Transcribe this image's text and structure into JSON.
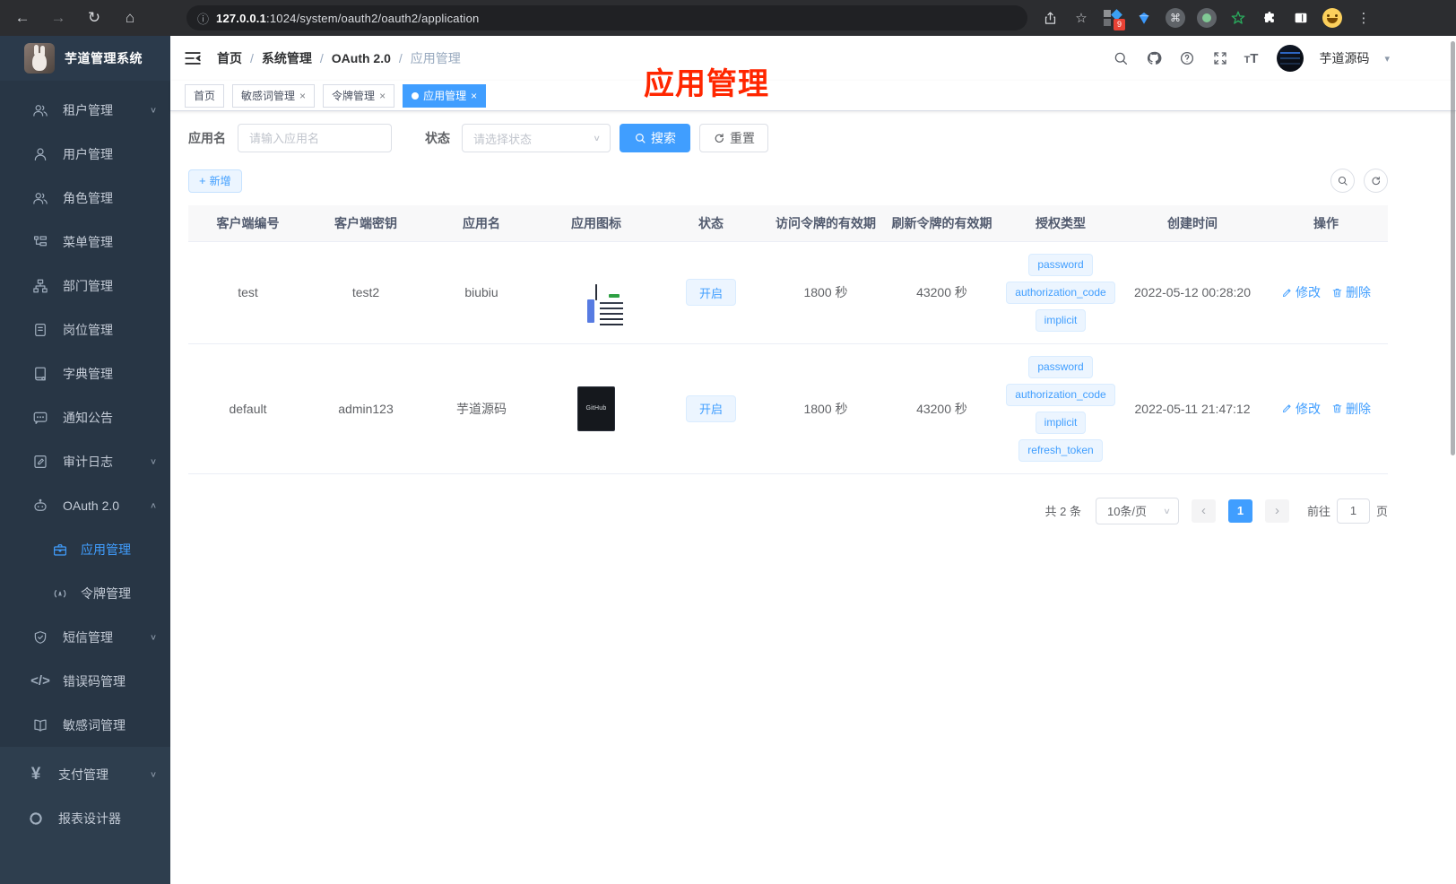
{
  "browser": {
    "url_host": "127.0.0.1",
    "url_path": ":1024/system/oauth2/oauth2/application",
    "extension_badge": "9"
  },
  "sidebar": {
    "title": "芋道管理系统",
    "items": [
      {
        "label": "租户管理"
      },
      {
        "label": "用户管理"
      },
      {
        "label": "角色管理"
      },
      {
        "label": "菜单管理"
      },
      {
        "label": "部门管理"
      },
      {
        "label": "岗位管理"
      },
      {
        "label": "字典管理"
      },
      {
        "label": "通知公告"
      },
      {
        "label": "审计日志"
      },
      {
        "label": "OAuth 2.0"
      },
      {
        "label": "应用管理"
      },
      {
        "label": "令牌管理"
      },
      {
        "label": "短信管理"
      },
      {
        "label": "错误码管理"
      },
      {
        "label": "敏感词管理"
      },
      {
        "label": "支付管理"
      },
      {
        "label": "报表设计器"
      }
    ]
  },
  "header": {
    "breadcrumb": {
      "home": "首页",
      "level1": "系统管理",
      "level2": "OAuth 2.0",
      "current": "应用管理",
      "separator": "/"
    },
    "username": "芋道源码"
  },
  "tabs": [
    {
      "label": "首页"
    },
    {
      "label": "敏感词管理"
    },
    {
      "label": "令牌管理"
    },
    {
      "label": "应用管理"
    }
  ],
  "annotation": "应用管理",
  "filter": {
    "name_label": "应用名",
    "name_placeholder": "请输入应用名",
    "status_label": "状态",
    "status_placeholder": "请选择状态",
    "search": "搜索",
    "reset": "重置",
    "add": "新增"
  },
  "table": {
    "columns": [
      "客户端编号",
      "客户端密钥",
      "应用名",
      "应用图标",
      "状态",
      "访问令牌的有效期",
      "刷新令牌的有效期",
      "授权类型",
      "创建时间",
      "操作"
    ],
    "rows": [
      {
        "client_id": "test",
        "client_secret": "test2",
        "app_name": "biubiu",
        "status": "开启",
        "access_token_ttl": "1800 秒",
        "refresh_token_ttl": "43200 秒",
        "grants": [
          "password",
          "authorization_code",
          "implicit"
        ],
        "created_at": "2022-05-12 00:28:20"
      },
      {
        "client_id": "default",
        "client_secret": "admin123",
        "app_name": "芋道源码",
        "icon_label": "GitHub",
        "status": "开启",
        "access_token_ttl": "1800 秒",
        "refresh_token_ttl": "43200 秒",
        "grants": [
          "password",
          "authorization_code",
          "implicit",
          "refresh_token"
        ],
        "created_at": "2022-05-11 21:47:12"
      }
    ],
    "actions": {
      "edit": "修改",
      "delete": "删除"
    }
  },
  "pagination": {
    "total": "共 2 条",
    "page_size": "10条/页",
    "page": "1",
    "goto": "前往",
    "goto_value": "1",
    "unit": "页"
  },
  "icons": {
    "close": "×",
    "chevron_down": "∨",
    "chevron_up": "∧",
    "caret": "▾",
    "plus": "+",
    "dots": "⋮",
    "code": "</>",
    "yen": "¥",
    "info": "ⓘ",
    "star": "☆",
    "back": "←",
    "forward": "→",
    "reload": "↻",
    "home": "⌂",
    "command": "⌘",
    "prev": "‹",
    "next": "›",
    "slash": "/"
  },
  "colors": {
    "accent": "#409eff",
    "annotation": "#ff2600",
    "tag_bg": "#ecf5ff",
    "sidebar_bg": "#283645"
  }
}
